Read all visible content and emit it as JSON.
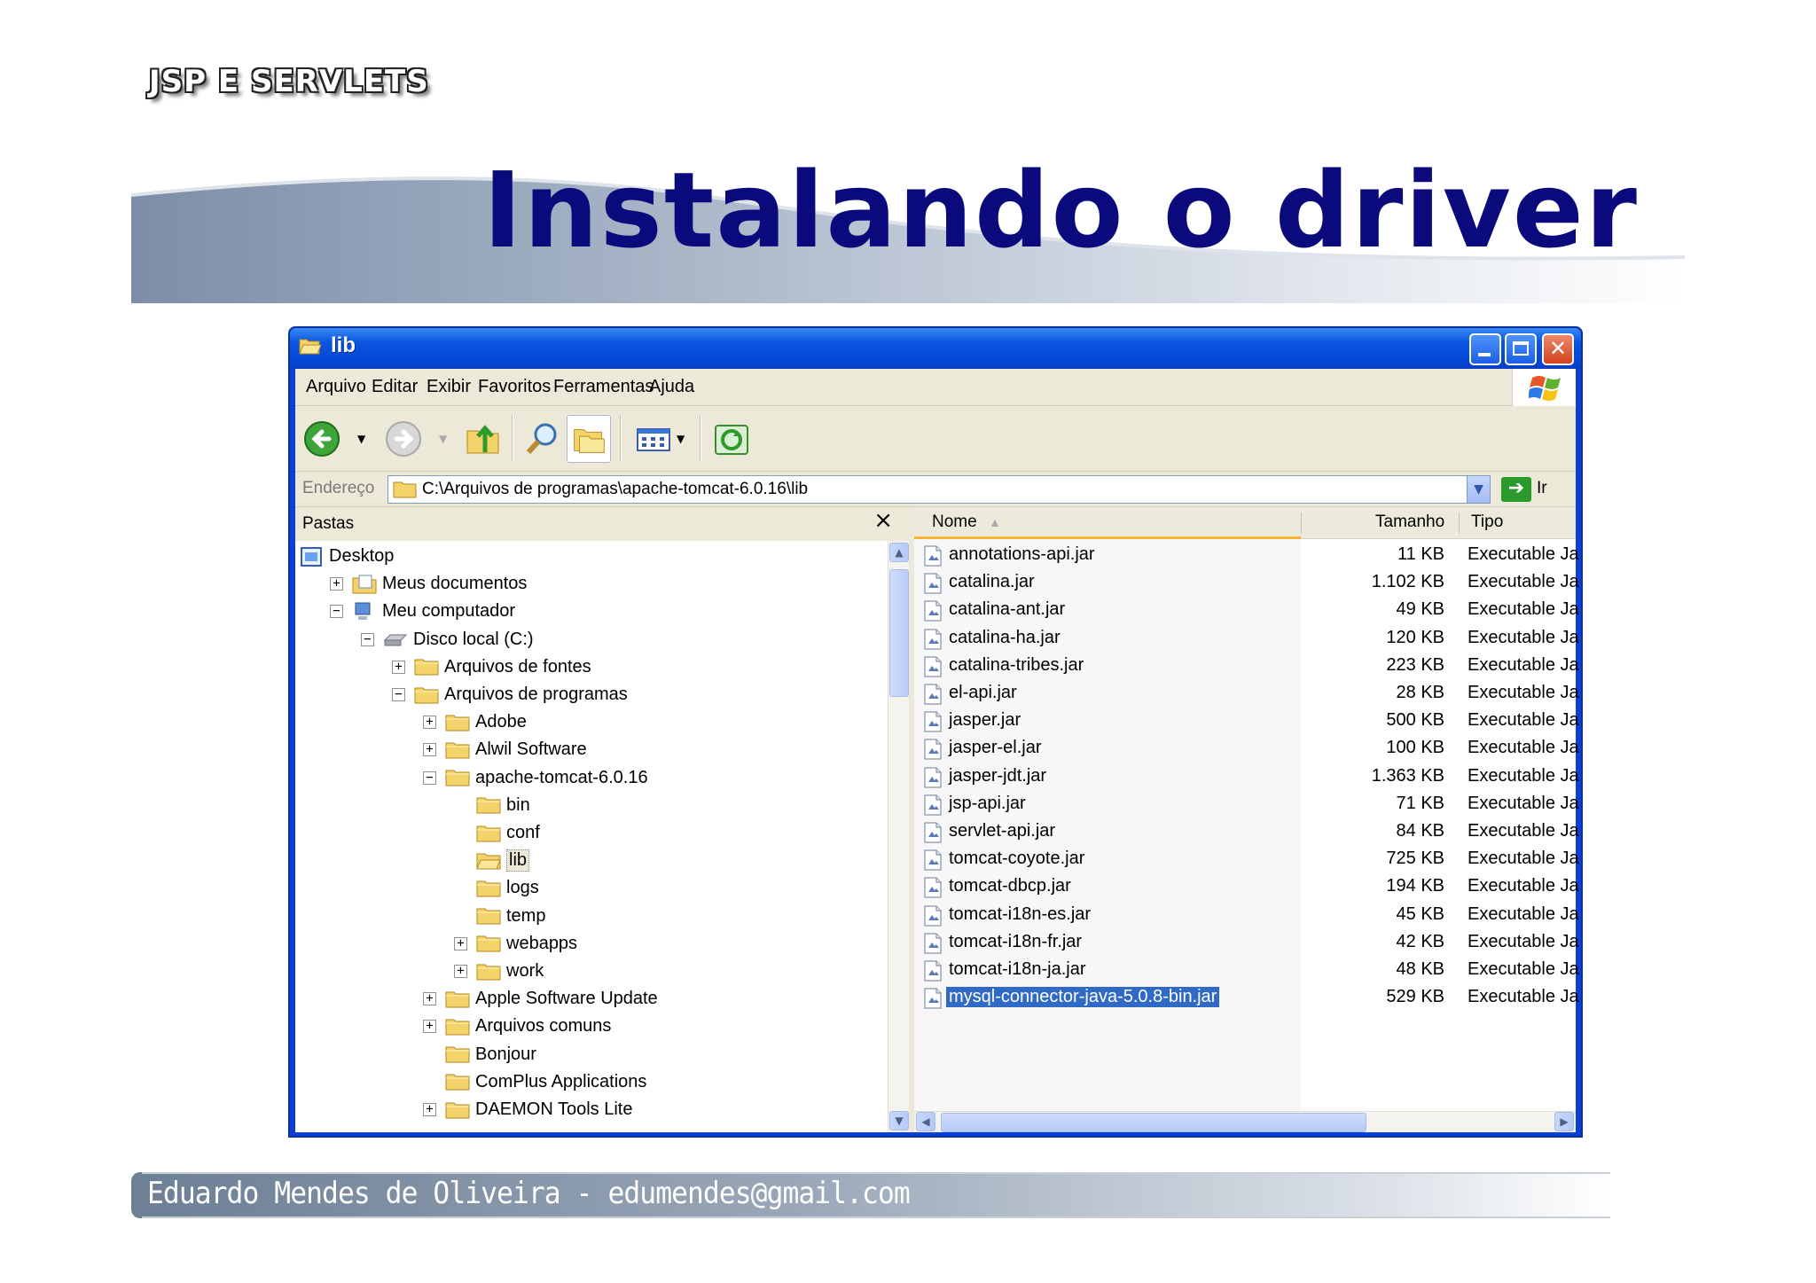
{
  "slide": {
    "logo": "JSP E SERVLETS",
    "title": "Instalando o driver",
    "footer": "Eduardo Mendes de Oliveira - edumendes@gmail.com"
  },
  "window": {
    "title": "lib",
    "icon": "folder-open-icon",
    "controls": [
      "minimize",
      "maximize",
      "close"
    ]
  },
  "menu": [
    "Arquivo",
    "Editar",
    "Exibir",
    "Favoritos",
    "Ferramentas",
    "Ajuda"
  ],
  "toolbar": {
    "buttons": [
      "back-icon",
      "forward-icon",
      "up-folder-icon",
      "search-icon",
      "folders-icon",
      "views-icon",
      "sync-icon"
    ]
  },
  "address": {
    "label": "Endereço",
    "value": "C:\\Arquivos de programas\\apache-tomcat-6.0.16\\lib",
    "go_label": "Ir"
  },
  "folders": {
    "title": "Pastas",
    "close": "×",
    "tree": [
      {
        "label": "Desktop",
        "level": 0,
        "toggle": "",
        "icon": "desktop-icon"
      },
      {
        "label": "Meus documentos",
        "level": 1,
        "toggle": "+",
        "icon": "my-documents-icon"
      },
      {
        "label": "Meu computador",
        "level": 1,
        "toggle": "−",
        "icon": "my-computer-icon"
      },
      {
        "label": "Disco local (C:)",
        "level": 2,
        "toggle": "−",
        "icon": "drive-icon"
      },
      {
        "label": "Arquivos de fontes",
        "level": 3,
        "toggle": "+",
        "icon": "folder-icon"
      },
      {
        "label": "Arquivos de programas",
        "level": 3,
        "toggle": "−",
        "icon": "folder-icon"
      },
      {
        "label": "Adobe",
        "level": 4,
        "toggle": "+",
        "icon": "folder-icon"
      },
      {
        "label": "Alwil Software",
        "level": 4,
        "toggle": "+",
        "icon": "folder-icon"
      },
      {
        "label": "apache-tomcat-6.0.16",
        "level": 4,
        "toggle": "−",
        "icon": "folder-icon"
      },
      {
        "label": "bin",
        "level": 5,
        "toggle": "",
        "icon": "folder-icon"
      },
      {
        "label": "conf",
        "level": 5,
        "toggle": "",
        "icon": "folder-icon"
      },
      {
        "label": "lib",
        "level": 5,
        "toggle": "",
        "icon": "folder-open-icon",
        "selected": true
      },
      {
        "label": "logs",
        "level": 5,
        "toggle": "",
        "icon": "folder-icon"
      },
      {
        "label": "temp",
        "level": 5,
        "toggle": "",
        "icon": "folder-icon"
      },
      {
        "label": "webapps",
        "level": 5,
        "toggle": "+",
        "icon": "folder-icon"
      },
      {
        "label": "work",
        "level": 5,
        "toggle": "+",
        "icon": "folder-icon"
      },
      {
        "label": "Apple Software Update",
        "level": 4,
        "toggle": "+",
        "icon": "folder-icon"
      },
      {
        "label": "Arquivos comuns",
        "level": 4,
        "toggle": "+",
        "icon": "folder-icon"
      },
      {
        "label": "Bonjour",
        "level": 4,
        "toggle": "",
        "icon": "folder-icon"
      },
      {
        "label": "ComPlus Applications",
        "level": 4,
        "toggle": "",
        "icon": "folder-icon"
      },
      {
        "label": "DAEMON Tools Lite",
        "level": 4,
        "toggle": "+",
        "icon": "folder-icon"
      }
    ]
  },
  "files": {
    "columns": {
      "name": "Nome",
      "size": "Tamanho",
      "type": "Tipo"
    },
    "rows": [
      {
        "name": "annotations-api.jar",
        "size": "11 KB",
        "type": "Executable Ja"
      },
      {
        "name": "catalina.jar",
        "size": "1.102 KB",
        "type": "Executable Ja"
      },
      {
        "name": "catalina-ant.jar",
        "size": "49 KB",
        "type": "Executable Ja"
      },
      {
        "name": "catalina-ha.jar",
        "size": "120 KB",
        "type": "Executable Ja"
      },
      {
        "name": "catalina-tribes.jar",
        "size": "223 KB",
        "type": "Executable Ja"
      },
      {
        "name": "el-api.jar",
        "size": "28 KB",
        "type": "Executable Ja"
      },
      {
        "name": "jasper.jar",
        "size": "500 KB",
        "type": "Executable Ja"
      },
      {
        "name": "jasper-el.jar",
        "size": "100 KB",
        "type": "Executable Ja"
      },
      {
        "name": "jasper-jdt.jar",
        "size": "1.363 KB",
        "type": "Executable Ja"
      },
      {
        "name": "jsp-api.jar",
        "size": "71 KB",
        "type": "Executable Ja"
      },
      {
        "name": "servlet-api.jar",
        "size": "84 KB",
        "type": "Executable Ja"
      },
      {
        "name": "tomcat-coyote.jar",
        "size": "725 KB",
        "type": "Executable Ja"
      },
      {
        "name": "tomcat-dbcp.jar",
        "size": "194 KB",
        "type": "Executable Ja"
      },
      {
        "name": "tomcat-i18n-es.jar",
        "size": "45 KB",
        "type": "Executable Ja"
      },
      {
        "name": "tomcat-i18n-fr.jar",
        "size": "42 KB",
        "type": "Executable Ja"
      },
      {
        "name": "tomcat-i18n-ja.jar",
        "size": "48 KB",
        "type": "Executable Ja"
      },
      {
        "name": "mysql-connector-java-5.0.8-bin.jar",
        "size": "529 KB",
        "type": "Executable Ja",
        "selected": true
      }
    ]
  },
  "colors": {
    "title_text": "#0a0a7c",
    "xp_blue": "#0a55e0",
    "selection": "#316ac5",
    "sort_accent": "#f9b234"
  }
}
